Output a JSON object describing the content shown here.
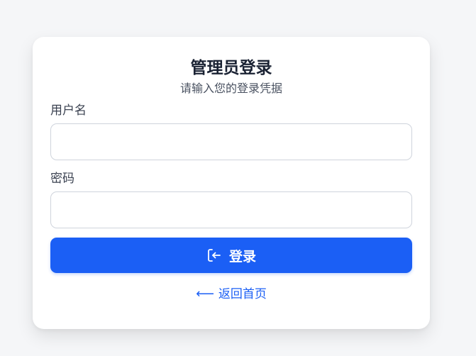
{
  "login_card": {
    "title": "管理员登录",
    "subtitle": "请输入您的登录凭据",
    "username": {
      "label": "用户名",
      "value": "",
      "placeholder": ""
    },
    "password": {
      "label": "密码",
      "value": "",
      "placeholder": ""
    },
    "login_button": {
      "label": "登录",
      "icon": "login-icon"
    },
    "back_link": {
      "label": "返回首页",
      "icon": "arrow-left-icon"
    }
  },
  "colors": {
    "accent": "#1b5ff5",
    "background": "#f5f6f8",
    "card": "#ffffff",
    "title_text": "#1a2233"
  }
}
